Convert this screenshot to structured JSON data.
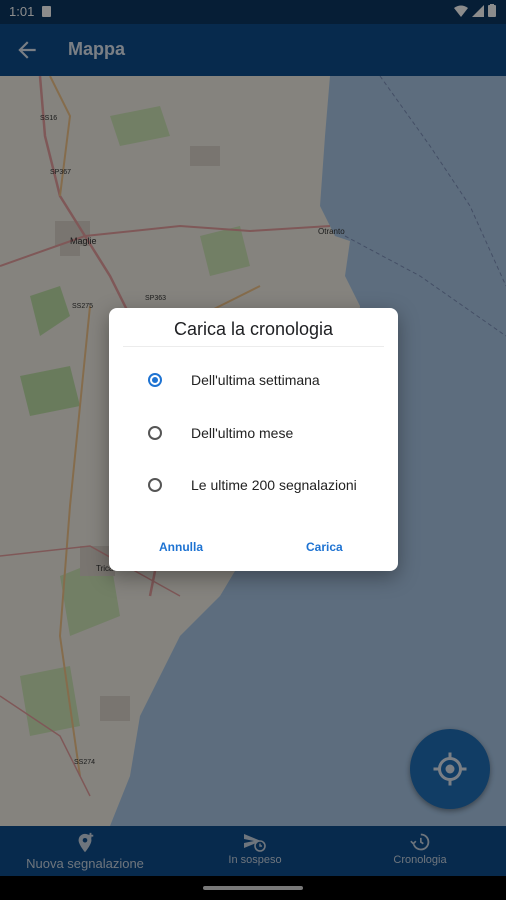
{
  "status_bar": {
    "time": "1:01"
  },
  "app_bar": {
    "title": "Mappa"
  },
  "map_labels": {
    "otranto": "Otranto",
    "maglie": "Maglie",
    "ss16": "SS16",
    "sp367": "SP367",
    "sp363": "SP363",
    "ss275": "SS275",
    "ss274": "SS274",
    "tricase": "Tricase"
  },
  "dialog": {
    "title": "Carica la cronologia",
    "options": [
      {
        "label": "Dell'ultima settimana",
        "checked": true
      },
      {
        "label": "Dell'ultimo mese",
        "checked": false
      },
      {
        "label": "Le ultime 200 segnalazioni",
        "checked": false
      }
    ],
    "cancel_label": "Annulla",
    "ok_label": "Carica"
  },
  "bottom_nav": {
    "items": [
      {
        "label": "Nuova segnalazione",
        "icon": "add-location-icon"
      },
      {
        "label": "In sospeso",
        "icon": "pending-send-icon"
      },
      {
        "label": "Cronologia",
        "icon": "history-icon"
      }
    ]
  },
  "colors": {
    "primary": "#0e4d8c",
    "accent": "#1e73d2",
    "fab": "#1f6fb8"
  }
}
